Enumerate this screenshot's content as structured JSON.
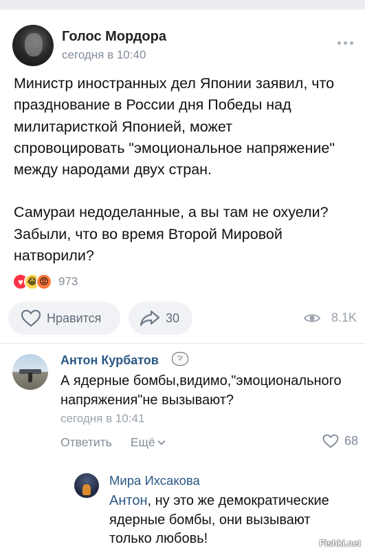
{
  "post": {
    "author": "Голос Мордора",
    "timestamp": "сегодня в 10:40",
    "paragraphs": [
      [
        "Министр иностранных дел Японии заявил, что",
        "празднование в России дня Победы над",
        "милитаристкой Японией, может",
        "спровоцировать \"эмоциональное напряжение\"",
        "между народами двух стран."
      ],
      [
        "Самураи недоделанные, а вы там не охуели?",
        "Забыли, что во время Второй Мировой",
        "натворили?"
      ]
    ],
    "reactions_count": "973",
    "like_label": "Нравится",
    "shares_count": "30",
    "views_count": "8.1K"
  },
  "comments": [
    {
      "author": "Антон Курбатов",
      "lines": [
        "А ядерные бомбы,видимо,\"эмоционального",
        "напряжения\"не вызывают?"
      ],
      "timestamp": "сегодня в 10:41",
      "reply_label": "Ответить",
      "more_label": "Ещё",
      "likes": "68"
    },
    {
      "author": "Мира Ихсакова",
      "mention": "Антон",
      "lines": [
        ", ну это же демократические",
        "ядерные бомбы, они вызывают",
        "только любовь!"
      ]
    }
  ],
  "watermark": "Fishki.net",
  "colors": {
    "link": "#2a5885",
    "secondary_text": "#818c99",
    "button_bg": "#f0f2f5",
    "heart_reaction": "#ff3347"
  }
}
